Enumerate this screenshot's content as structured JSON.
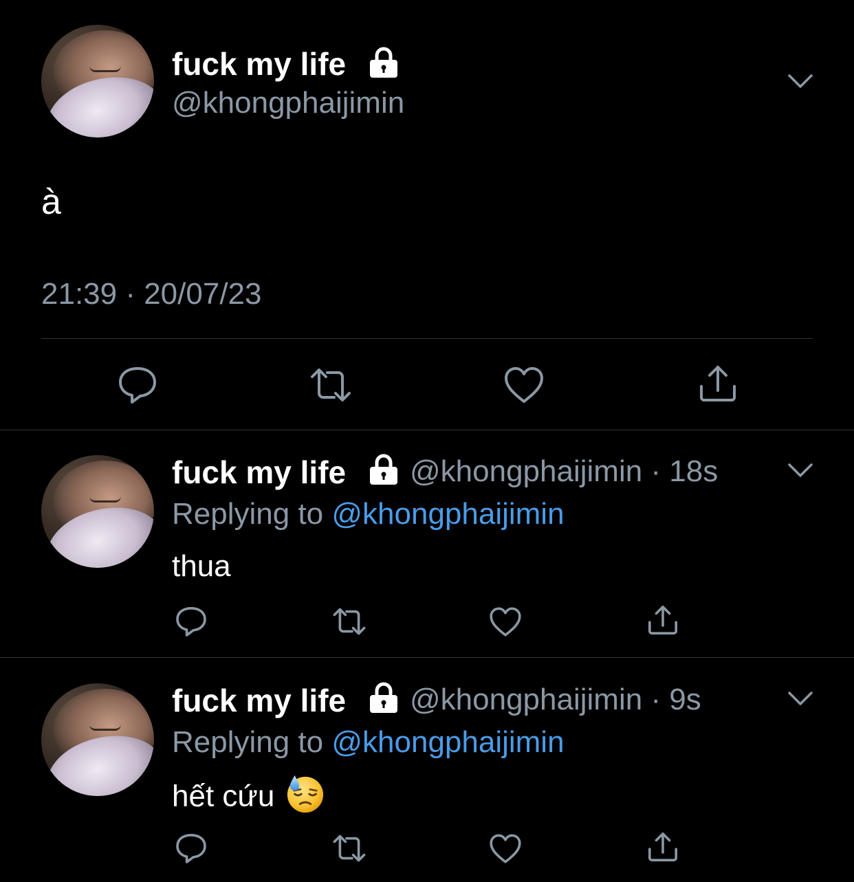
{
  "colors": {
    "background": "#000000",
    "primary_text": "#ffffff",
    "secondary_text": "#8b98a5",
    "mention": "#4a9ce8",
    "divider": "#2f3336",
    "icon": "#8b98a5"
  },
  "main_tweet": {
    "display_name": "fuck my life",
    "handle": "@khongphaijimin",
    "text": "à",
    "timestamp": "21:39 · 20/07/23",
    "protected_icon": "lock-icon",
    "menu_icon": "chevron-down-icon",
    "actions": [
      "reply-icon",
      "retweet-icon",
      "like-icon",
      "share-icon"
    ]
  },
  "replies": [
    {
      "display_name": "fuck my life",
      "handle_time": "@khongphaijimin · 18s",
      "replying_prefix": "Replying to ",
      "replying_to": "@khongphaijimin",
      "text": "thua",
      "emoji": ""
    },
    {
      "display_name": "fuck my life",
      "handle_time": "@khongphaijimin · 9s",
      "replying_prefix": "Replying to ",
      "replying_to": "@khongphaijimin",
      "text": "hết cứu",
      "emoji": "downcast-face-with-sweat-icon"
    }
  ]
}
